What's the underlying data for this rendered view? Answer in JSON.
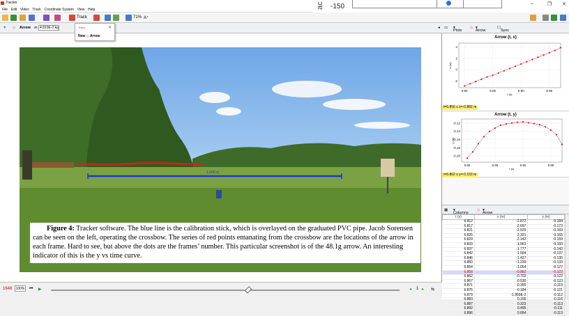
{
  "app": {
    "title": "Tracker"
  },
  "menu": [
    "File",
    "Edit",
    "Video",
    "Track",
    "Coordinate System",
    "View",
    "Help"
  ],
  "background_window": {
    "ac": "ac",
    "value": "-150"
  },
  "toolbar": {
    "track_label": "Track",
    "zoom_label": "71%"
  },
  "track_bar": {
    "track_name": "Arrow",
    "mass_label": "m",
    "mass_value": "4.810E-2 kg"
  },
  "popup": {
    "title": "Track",
    "new_label": "New",
    "arrow_label": "Arrow"
  },
  "photo": {
    "calibration_label": "1.000 m"
  },
  "caption": {
    "lead": "Figure 4:",
    "text": " Tracker software. The blue line is the calibration stick, which is overlayed on the graduated PVC pipe. Jacob Sorensen can be seen on the left, operating the crossbow. The series of red points emanating from the crossbow are the locations of the arrow in each frame. Hard to see, but above the dots are the frames’ number. This particular screenshot is of the 48.1g arrow. An interesting indicator of this is the y vs time curve."
  },
  "bottom": {
    "frame_number": "1648",
    "zoom_percent": "100%",
    "step_count": "1"
  },
  "plots_bar": {
    "plots_label": "Plots",
    "track_label": "Arrow",
    "sync_label": "Sync"
  },
  "plot1": {
    "title": "Arrow (t, x)",
    "ylabel": "x (m)",
    "xlabel": "t (s)",
    "status": "t=6.856 s  x=-0.882 m",
    "yticks": [
      "4",
      "2",
      "0",
      "-2"
    ],
    "xticks": [
      "6.80",
      "6.85",
      "6.90",
      "6.95"
    ]
  },
  "plot2": {
    "title": "Arrow (t, y)",
    "ylabel": "y (m)",
    "xlabel": "t (s)",
    "status": "t=6.862 s  y=-0.153 m",
    "yticks": [
      "-0.12",
      "-0.14",
      "-0.16",
      "-0.18",
      "-0.20"
    ],
    "xticks": [
      "6.80",
      "6.85",
      "6.90",
      "6.95"
    ]
  },
  "chart_data": [
    {
      "type": "scatter",
      "title": "Arrow (t, x)",
      "xlabel": "t (s)",
      "ylabel": "x (m)",
      "xlim": [
        6.79,
        6.97
      ],
      "ylim": [
        -3.2,
        4.7
      ],
      "x": [
        6.8,
        6.81,
        6.82,
        6.83,
        6.84,
        6.85,
        6.86,
        6.87,
        6.88,
        6.89,
        6.9,
        6.91,
        6.92,
        6.93,
        6.94,
        6.95,
        6.96,
        6.97
      ],
      "y": [
        -2.9,
        -2.5,
        -2.1,
        -1.7,
        -1.3,
        -1.0,
        -0.6,
        -0.2,
        0.2,
        0.6,
        1.0,
        1.4,
        1.8,
        2.2,
        2.6,
        3.0,
        3.4,
        3.9
      ]
    },
    {
      "type": "scatter",
      "title": "Arrow (t, y)",
      "xlabel": "t (s)",
      "ylabel": "y (m)",
      "xlim": [
        6.79,
        6.97
      ],
      "ylim": [
        -0.215,
        -0.11
      ],
      "x": [
        6.8,
        6.81,
        6.82,
        6.83,
        6.84,
        6.85,
        6.86,
        6.87,
        6.88,
        6.89,
        6.9,
        6.91,
        6.92,
        6.93,
        6.94,
        6.95,
        6.96,
        6.97
      ],
      "y": [
        -0.205,
        -0.19,
        -0.17,
        -0.153,
        -0.14,
        -0.132,
        -0.125,
        -0.122,
        -0.12,
        -0.118,
        -0.117,
        -0.119,
        -0.121,
        -0.124,
        -0.129,
        -0.137,
        -0.148,
        -0.172
      ]
    }
  ],
  "table_bar": {
    "columns_label": "Columns",
    "track_label": "Arrow"
  },
  "table": {
    "headers": [
      "t (s)",
      "x (m)",
      "y (m)"
    ],
    "rows": [
      [
        "6.812",
        "-2.872",
        "-0.184"
      ],
      [
        "6.817",
        "-2.697",
        "-0.173"
      ],
      [
        "6.821",
        "-2.529",
        "-0.169"
      ],
      [
        "6.825",
        "-2.331",
        "-0.165"
      ],
      [
        "6.829",
        "-2.142",
        "-0.159"
      ],
      [
        "6.833",
        "-1.963",
        "-0.150"
      ],
      [
        "6.837",
        "-1.777",
        "-0.143"
      ],
      [
        "6.842",
        "-1.594",
        "-0.137"
      ],
      [
        "6.846",
        "-1.427",
        "-0.135"
      ],
      [
        "6.850",
        "-1.239",
        "-0.133"
      ],
      [
        "6.854",
        "-1.054",
        "-0.127"
      ],
      [
        "6.858",
        "-0.882",
        "-0.122"
      ],
      [
        "6.862",
        "-0.702",
        "-0.122"
      ],
      [
        "6.867",
        "-0.530",
        "-0.123"
      ],
      [
        "6.871",
        "-0.355",
        "-0.119"
      ],
      [
        "6.875",
        "-0.184",
        "-0.121"
      ],
      [
        "6.879",
        "-1.959E-2",
        "-0.112"
      ],
      [
        "6.883",
        "0.156",
        "-0.116"
      ],
      [
        "6.887",
        "0.323",
        "-0.113"
      ],
      [
        "6.892",
        "0.495",
        "-0.111"
      ],
      [
        "6.896",
        "0.664",
        "-0.113"
      ]
    ],
    "selected_index": 11
  }
}
